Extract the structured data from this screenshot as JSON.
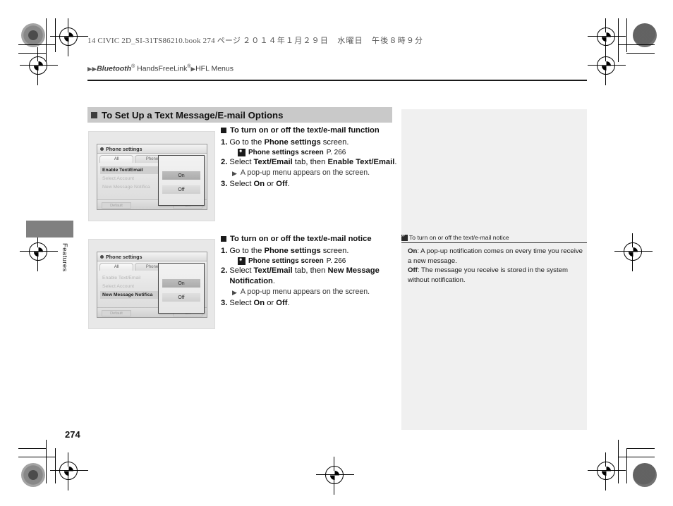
{
  "header": {
    "book_line_ascii": "14 CIVIC 2D_SI-31TS86210.book    274 ページ",
    "book_line_jp": "２０１４年１月２９日　水曜日　午後８時９分",
    "breadcrumb_bluetooth": "Bluetooth",
    "breadcrumb_hfl": " HandsFreeLink",
    "breadcrumb_tail": "HFL Menus",
    "registered_mark": "®"
  },
  "side_tab": {
    "label": "Features"
  },
  "section": {
    "title": "To Set Up a Text Message/E-mail Options"
  },
  "blocks": [
    {
      "heading": "To turn on or off the text/e-mail function",
      "steps": [
        {
          "num": "1.",
          "pre": "Go to the ",
          "bold": "Phone settings",
          "post": " screen."
        },
        {
          "num": "2.",
          "pre": "Select ",
          "bold": "Text/Email",
          "mid": " tab, then ",
          "bold2": "Enable Text/Email",
          "post": "."
        },
        {
          "num": "3.",
          "pre": "Select ",
          "bold": "On",
          "mid": " or ",
          "bold2": "Off",
          "post": "."
        }
      ],
      "xref": {
        "label": "Phone settings screen",
        "page": "P. 266"
      },
      "bullet": "A pop-up menu appears on the screen."
    },
    {
      "heading": "To turn on or off the text/e-mail notice",
      "steps": [
        {
          "num": "1.",
          "pre": "Go to the ",
          "bold": "Phone settings",
          "post": " screen."
        },
        {
          "num": "2.",
          "pre": "Select ",
          "bold": "Text/Email",
          "mid": " tab, then ",
          "bold2": "New Message Notification",
          "post": "."
        },
        {
          "num": "3.",
          "pre": "Select ",
          "bold": "On",
          "mid": " or ",
          "bold2": "Off",
          "post": "."
        }
      ],
      "xref": {
        "label": "Phone settings screen",
        "page": "P. 266"
      },
      "bullet": "A pop-up menu appears on the screen."
    }
  ],
  "note": {
    "heading": "To turn on or off the text/e-mail notice",
    "on_label": "On",
    "on_text": ": A pop-up notification comes on every time you receive a new message.",
    "off_label": "Off",
    "off_text": ": The message you receive is stored in the system without notification."
  },
  "figures": [
    {
      "name": "phone-settings-enable-text-email",
      "title": "Phone settings",
      "tabs": [
        "All",
        "Phone",
        ""
      ],
      "selected_tab": "All",
      "rows": [
        {
          "label": "Enable Text/Email",
          "active": true
        },
        {
          "label": "Select Account",
          "active": false
        },
        {
          "label": "New Message Notifica",
          "active": false
        }
      ],
      "buttons": {
        "default": "Default",
        "ok": "OK"
      },
      "popup": {
        "on": "On",
        "off": "Off"
      }
    },
    {
      "name": "phone-settings-new-message-notification",
      "title": "Phone settings",
      "tabs": [
        "All",
        "Phone",
        ""
      ],
      "selected_tab": "All",
      "rows": [
        {
          "label": "Enable Text/Email",
          "active": false
        },
        {
          "label": "Select Account",
          "active": false
        },
        {
          "label": "New Message Notifica",
          "active": true
        }
      ],
      "buttons": {
        "default": "Default",
        "ok": "OK"
      },
      "popup": {
        "on": "On",
        "off": "Off"
      }
    }
  ],
  "page_number": "274",
  "colors": {
    "band": "#c9c9c9",
    "note_panel": "#f0f0f0",
    "tab": "#808080"
  }
}
